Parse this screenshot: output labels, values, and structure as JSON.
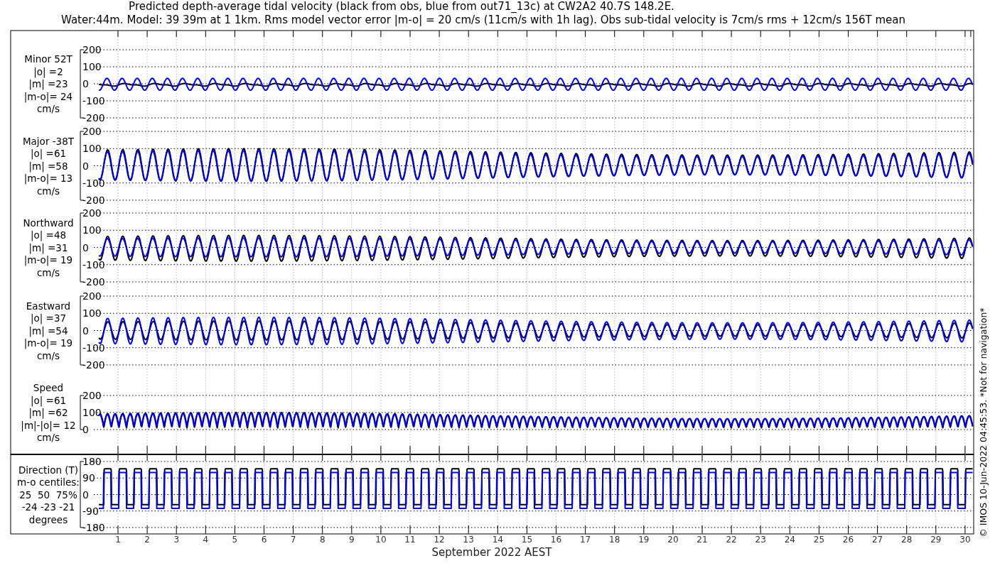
{
  "title": [
    "Predicted depth-average tidal velocity (black from obs, blue from out71_13c) at CW2A2 40.7S 148.2E.",
    "Water:44m. Model: 39 39m at 1 1km. Rms model vector error |m-o| = 20 cm/s (11cm/s with 1h lag). Obs sub-tidal velocity is 7cm/s rms + 12cm/s 156T mean"
  ],
  "series": [
    {
      "kind": "obs",
      "color": "#000000"
    },
    {
      "kind": "model",
      "color": "#0000ff"
    }
  ],
  "panels": [
    {
      "kind": "minor",
      "label": [
        "Minor 52T",
        "|o| =2",
        "|m| =23",
        "|m-o|= 24",
        "cm/s"
      ],
      "yticks": [
        "200",
        "100",
        "0",
        "-100",
        "-200"
      ]
    },
    {
      "kind": "major",
      "label": [
        "Major -38T",
        "|o| =61",
        "|m| =58",
        "|m-o|= 13",
        "cm/s"
      ],
      "yticks": [
        "200",
        "100",
        "0",
        "-100",
        "-200"
      ]
    },
    {
      "kind": "northward",
      "label": [
        "Northward",
        "|o| =48",
        "|m| =31",
        "|m-o|= 19",
        "cm/s"
      ],
      "yticks": [
        "200",
        "100",
        "0",
        "-100",
        "-200"
      ]
    },
    {
      "kind": "eastward",
      "label": [
        "Eastward",
        "|o| =37",
        "|m| =54",
        "|m-o|= 19",
        "cm/s"
      ],
      "yticks": [
        "200",
        "100",
        "0",
        "-100",
        "-200"
      ]
    },
    {
      "kind": "speed",
      "label": [
        "Speed",
        "|o| =61",
        "|m| =62",
        "|m|-|o|= 12",
        "cm/s"
      ],
      "yticks": [
        "200",
        "100",
        "0"
      ]
    },
    {
      "kind": "direction",
      "label": [
        "Direction (T)",
        "m-o centiles:",
        "25  50  75%",
        "-24 -23 -21",
        "degrees"
      ],
      "yticks": [
        "180",
        "90",
        "0",
        "-90",
        "-180"
      ]
    }
  ],
  "xticks": [
    "1",
    "2",
    "3",
    "4",
    "5",
    "6",
    "7",
    "8",
    "9",
    "10",
    "11",
    "12",
    "13",
    "14",
    "15",
    "16",
    "17",
    "18",
    "19",
    "20",
    "21",
    "22",
    "23",
    "24",
    "25",
    "26",
    "27",
    "28",
    "29",
    "30"
  ],
  "xlabel": "September 2022 AEST",
  "credit": "© IMOS 10-Jun-2022 04:45:53. *Not for navigation*"
}
